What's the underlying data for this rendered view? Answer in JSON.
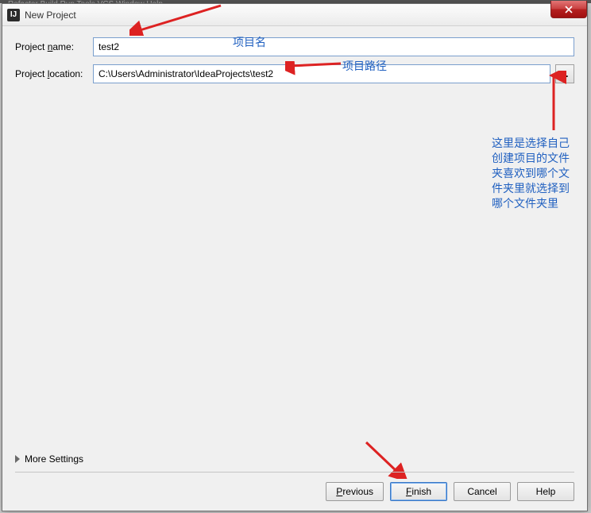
{
  "menubar_hint": "Refactor  Build  Run  Tools  VCS  Window  Help",
  "dialog": {
    "title": "New Project",
    "app_icon_label": "IJ"
  },
  "fields": {
    "project_name": {
      "label_prefix": "Project ",
      "label_key": "n",
      "label_suffix": "ame:",
      "value": "test2"
    },
    "project_location": {
      "label_prefix": "Project ",
      "label_key": "l",
      "label_suffix": "ocation:",
      "value": "C:\\Users\\Administrator\\IdeaProjects\\test2"
    },
    "browse_label": "..."
  },
  "annotations": {
    "name_hint": "项目名",
    "location_hint": "项目路径",
    "side_note": "这里是选择自己创建项目的文件夹喜欢到哪个文件夹里就选择到哪个文件夹里"
  },
  "more_settings_label": "More Settings",
  "buttons": {
    "previous_key": "P",
    "previous_rest": "revious",
    "finish_key": "F",
    "finish_rest": "inish",
    "cancel": "Cancel",
    "help": "Help"
  }
}
